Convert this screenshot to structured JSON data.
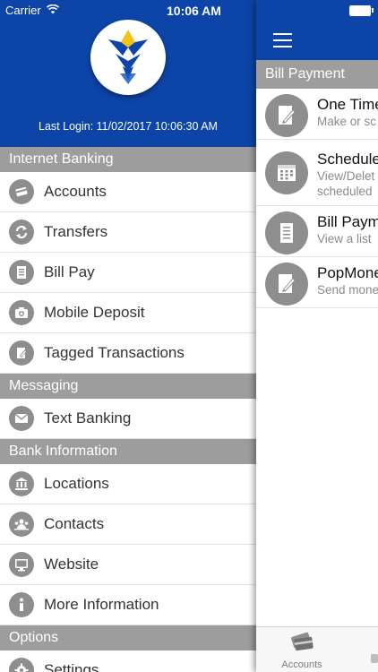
{
  "status_bar": {
    "carrier": "Carrier",
    "time": "10:06 AM",
    "wifi_icon": "wifi-icon",
    "battery_icon": "battery-icon"
  },
  "drawer": {
    "last_login": "Last Login: 11/02/2017 10:06:30 AM",
    "sections": [
      {
        "title": "Internet Banking",
        "items": [
          {
            "label": "Accounts",
            "icon": "card-icon"
          },
          {
            "label": "Transfers",
            "icon": "transfer-icon"
          },
          {
            "label": "Bill Pay",
            "icon": "document-icon"
          },
          {
            "label": "Mobile Deposit",
            "icon": "camera-icon"
          },
          {
            "label": "Tagged Transactions",
            "icon": "tag-icon"
          }
        ]
      },
      {
        "title": "Messaging",
        "items": [
          {
            "label": "Text Banking",
            "icon": "envelope-icon"
          }
        ]
      },
      {
        "title": "Bank Information",
        "items": [
          {
            "label": "Locations",
            "icon": "bank-icon"
          },
          {
            "label": "Contacts",
            "icon": "contacts-icon"
          },
          {
            "label": "Website",
            "icon": "monitor-icon"
          },
          {
            "label": "More Information",
            "icon": "info-icon"
          }
        ]
      },
      {
        "title": "Options",
        "items": [
          {
            "label": "Settings",
            "icon": "gear-icon"
          }
        ]
      }
    ]
  },
  "panel": {
    "section_title": "Bill Payment",
    "items": [
      {
        "title": "One Time",
        "subtitle": "Make or sc",
        "icon": "edit-document-icon"
      },
      {
        "title": "Schedule",
        "subtitle": "View/Delet",
        "subtitle2": "scheduled",
        "icon": "calendar-icon"
      },
      {
        "title": "Bill Paym",
        "subtitle": "View a list",
        "icon": "document-list-icon"
      },
      {
        "title": "PopMone",
        "subtitle": "Send mone",
        "icon": "edit-document-icon"
      }
    ],
    "tabbar": {
      "accounts_label": "Accounts"
    }
  },
  "colors": {
    "brand_blue": "#0c45a7",
    "section_gray": "#9d9d9d",
    "icon_gray": "#8e8e8e",
    "logo_yellow": "#f2c318"
  }
}
